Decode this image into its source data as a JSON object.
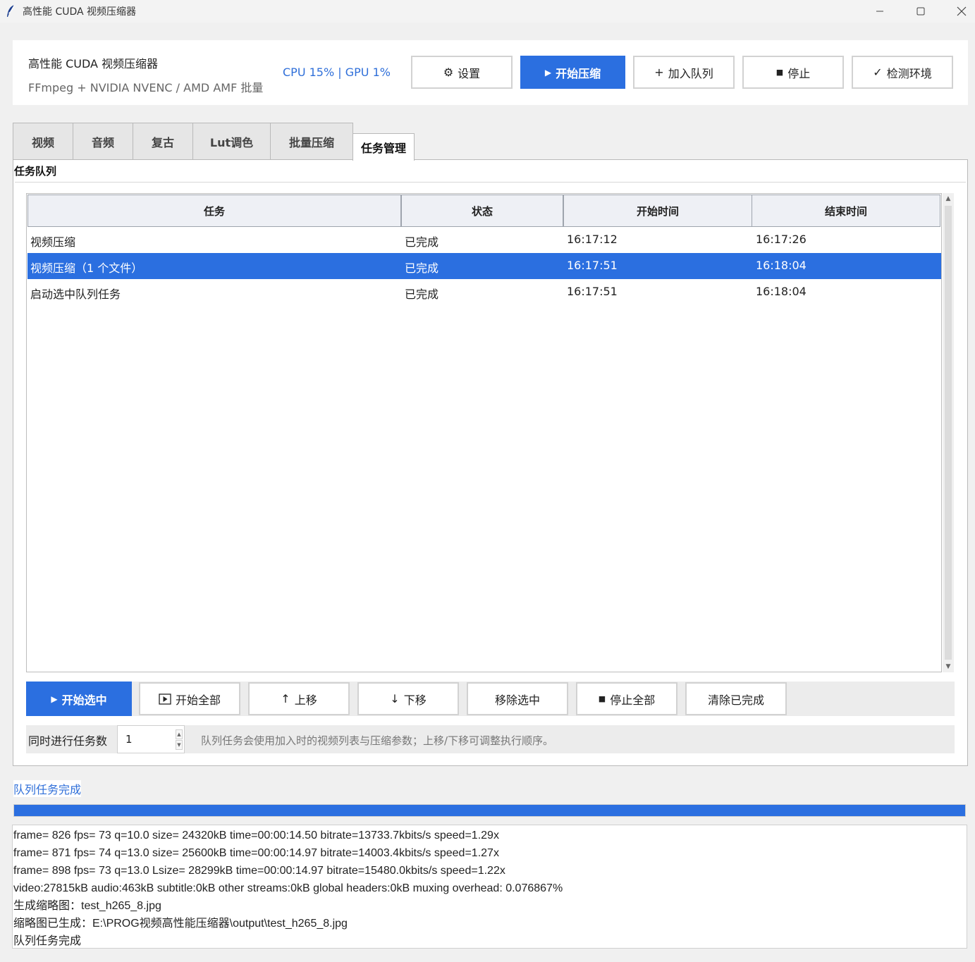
{
  "window": {
    "title": "高性能 CUDA 视频压缩器",
    "minimize_glyph": "—",
    "maximize_glyph": "☐",
    "close_glyph": "✕"
  },
  "header": {
    "app_name": "高性能 CUDA 视频压缩器",
    "subtitle": "FFmpeg + NVIDIA NVENC / AMD AMF 批量",
    "stats": "CPU 15%  |  GPU 1%",
    "buttons": {
      "settings": {
        "icon": "gear-icon",
        "glyph": "⚙",
        "label": "设置"
      },
      "start": {
        "icon": "play-icon",
        "glyph": "▶",
        "label": "开始压缩"
      },
      "add_queue": {
        "icon": "plus-icon",
        "glyph": "+",
        "label": "加入队列"
      },
      "stop": {
        "icon": "stop-icon",
        "glyph": "■",
        "label": "停止"
      },
      "check_env": {
        "icon": "check-icon",
        "glyph": "✓",
        "label": "检测环境"
      }
    }
  },
  "tabs": [
    {
      "label": "视频"
    },
    {
      "label": "音频"
    },
    {
      "label": "复古"
    },
    {
      "label": "Lut调色"
    },
    {
      "label": "批量压缩"
    },
    {
      "label": "任务管理"
    }
  ],
  "active_tab": "任务管理",
  "queue": {
    "group_title": "任务队列",
    "columns": [
      "任务",
      "状态",
      "开始时间",
      "结束时间"
    ],
    "rows": [
      {
        "task": "视频压缩",
        "status": "已完成",
        "start": "16:17:12",
        "end": "16:17:26",
        "selected": false
      },
      {
        "task": "视频压缩（1 个文件）",
        "status": "已完成",
        "start": "16:17:51",
        "end": "16:18:04",
        "selected": true
      },
      {
        "task": "启动选中队列任务",
        "status": "已完成",
        "start": "16:17:51",
        "end": "16:18:04",
        "selected": false
      }
    ],
    "scroll_up_glyph": "▲",
    "scroll_down_glyph": "▼"
  },
  "actions": {
    "start_selected": {
      "glyph": "▶",
      "label": "开始选中"
    },
    "start_all": {
      "glyph": "▶",
      "label": "开始全部"
    },
    "move_up": {
      "glyph": "↑",
      "label": "上移"
    },
    "move_down": {
      "glyph": "↓",
      "label": "下移"
    },
    "remove_selected": {
      "label": "移除选中"
    },
    "stop_all": {
      "glyph": "■",
      "label": "停止全部"
    },
    "clear_done": {
      "label": "清除已完成"
    }
  },
  "concurrency": {
    "label": "同时进行任务数",
    "value": "1",
    "hint": "队列任务会使用加入时的视频列表与压缩参数；上移/下移可调整执行顺序。",
    "up_glyph": "▲",
    "down_glyph": "▼"
  },
  "status": {
    "text": "队列任务完成",
    "progress": 1.0
  },
  "log": [
    "frame=  826 fps= 73 q=10.0 size=   24320kB time=00:00:14.50 bitrate=13733.7kbits/s speed=1.29x",
    "frame=  871 fps= 74 q=13.0 size=   25600kB time=00:00:14.97 bitrate=14003.4kbits/s speed=1.27x",
    "frame=  898 fps= 73 q=13.0 Lsize=   28299kB time=00:00:14.97 bitrate=15480.0kbits/s speed=1.22x",
    "video:27815kB audio:463kB subtitle:0kB other streams:0kB global headers:0kB muxing overhead: 0.076867%",
    "生成缩略图：test_h265_8.jpg",
    "缩略图已生成：E:\\PROG视频高性能压缩器\\output\\test_h265_8.jpg",
    "队列任务完成"
  ],
  "colors": {
    "accent": "#2b6fe0",
    "stats_text": "#2f6fd9"
  }
}
